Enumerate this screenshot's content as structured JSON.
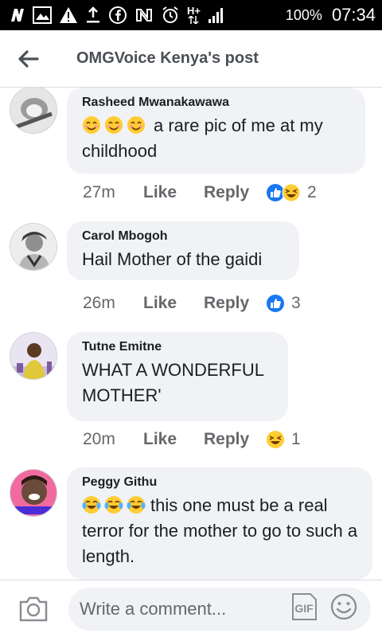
{
  "status_bar": {
    "battery": "100%",
    "time": "07:34",
    "network": "H+"
  },
  "header": {
    "title": "OMGVoice Kenya's post"
  },
  "comments": [
    {
      "author": "Rasheed Mwanakawawa",
      "text": "a rare pic of me at my childhood",
      "time": "27m",
      "like_label": "Like",
      "reply_label": "Reply",
      "reaction_count": "2",
      "reactions": [
        "like",
        "haha"
      ]
    },
    {
      "author": "Carol Mbogoh",
      "text": "Hail Mother of the gaidi",
      "time": "26m",
      "like_label": "Like",
      "reply_label": "Reply",
      "reaction_count": "3",
      "reactions": [
        "like"
      ]
    },
    {
      "author": "Tutne Emitne",
      "text": "WHAT A WONDERFUL MOTHER'",
      "time": "20m",
      "like_label": "Like",
      "reply_label": "Reply",
      "reaction_count": "1",
      "reactions": [
        "haha"
      ]
    },
    {
      "author": "Peggy Githu",
      "text": "this one must be a real terror for the mother to go to such a length.",
      "emojis": [
        "tears-of-joy",
        "tears-of-joy",
        "tears-of-joy"
      ]
    }
  ],
  "composer": {
    "placeholder": "Write a comment...",
    "gif_label": "GIF"
  },
  "colors": {
    "facebook_blue": "#1877f2",
    "bubble": "#f0f2f5",
    "text": "#1c1e21",
    "meta": "#65676b"
  }
}
